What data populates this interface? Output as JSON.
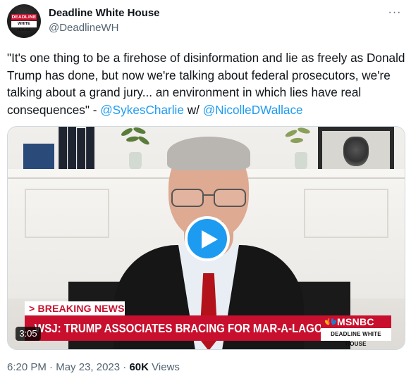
{
  "author": {
    "display_name": "Deadline White House",
    "handle": "@DeadlineWH",
    "avatar_top_text": "DEADLINE",
    "avatar_bottom_text": "WHITE HOUSE"
  },
  "more_icon": "more-horizontal-icon",
  "tweet": {
    "text_before": "\"It's one thing to be a firehose of disinformation and lie as freely as Donald Trump has done, but now we're talking about federal prosecutors, we're talking about a grand jury... an environment in which lies have real consequences\" - ",
    "mention_1": "@SykesCharlie",
    "text_between": " w/ ",
    "mention_2": "@NicolleDWallace"
  },
  "video": {
    "breaking_label": "> BREAKING NEWS",
    "headline": "WSJ: TRUMP ASSOCIATES BRACING FOR MAR-A-LAGO INDICTMENT",
    "network": "MSNBC",
    "show_name": "DEADLINE WHITE HOUSE",
    "duration": "3:05",
    "play_icon": "play-icon"
  },
  "meta": {
    "time": "6:20 PM",
    "separator": " · ",
    "date": "May 23, 2023",
    "views_count": "60K",
    "views_label": " Views"
  },
  "colors": {
    "accent": "#1d9bf0",
    "text": "#0f1419",
    "secondary": "#536471",
    "breaking_red": "#c8102e"
  }
}
